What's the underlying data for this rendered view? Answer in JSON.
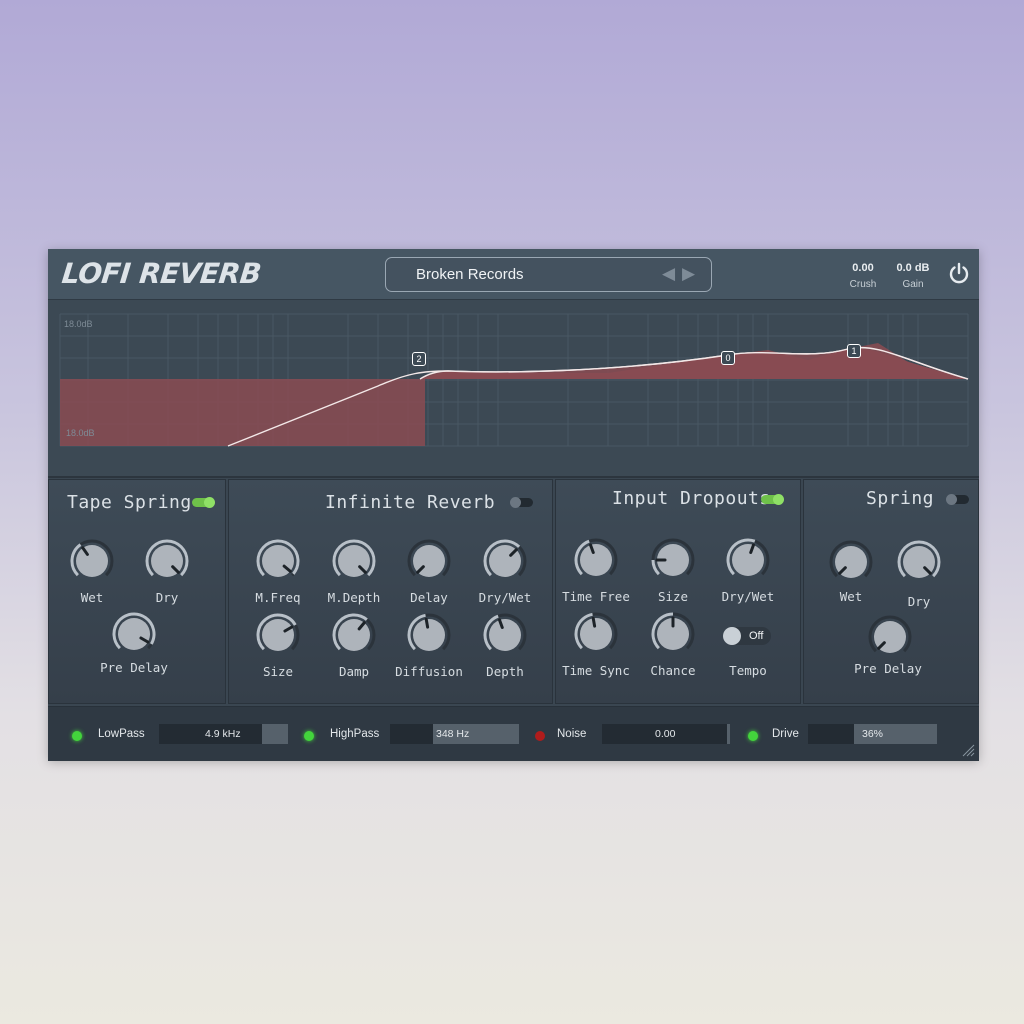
{
  "header": {
    "logo": "LOFI REVERB",
    "preset": "Broken Records",
    "crush_value": "0.00",
    "crush_label": "Crush",
    "gain_value": "0.0 dB",
    "gain_label": "Gain",
    "prev_icon": "triangle-left",
    "next_icon": "triangle-right",
    "power_icon": "power"
  },
  "eq": {
    "top_label": "18.0dB",
    "bottom_label": "18.0dB",
    "nodes": [
      "2",
      "0",
      "1"
    ],
    "fill_color": "#8a4b52",
    "curve_color": "#f3e8e8"
  },
  "panels": {
    "tape_spring": {
      "title": "Tape Spring",
      "enabled": true,
      "knobs": [
        "Wet",
        "Dry",
        "Pre Delay"
      ]
    },
    "infinite_reverb": {
      "title": "Infinite Reverb",
      "enabled": false,
      "knobs": [
        "M.Freq",
        "M.Depth",
        "Delay",
        "Dry/Wet",
        "Size",
        "Damp",
        "Diffusion",
        "Depth"
      ]
    },
    "input_dropouts": {
      "title": "Input Dropouts",
      "enabled": true,
      "knobs": [
        "Time Free",
        "Size",
        "Dry/Wet",
        "Time Sync",
        "Chance"
      ],
      "tempo_label": "Tempo",
      "tempo_state": "Off"
    },
    "spring": {
      "title": "Spring",
      "enabled": false,
      "knobs": [
        "Wet",
        "Dry",
        "Pre Delay"
      ]
    }
  },
  "bottom": {
    "lowpass": {
      "label": "LowPass",
      "value": "4.9 kHz",
      "led": "green",
      "fill": 0.2
    },
    "highpass": {
      "label": "HighPass",
      "value": "348 Hz",
      "led": "green",
      "fill": 0.67
    },
    "noise": {
      "label": "Noise",
      "value": "0.00",
      "led": "red",
      "fill": 0.02
    },
    "drive": {
      "label": "Drive",
      "value": "36%",
      "led": "green",
      "fill": 0.64
    }
  },
  "colors": {
    "accent_green": "#6fc14a",
    "led_green": "#43d43c",
    "led_red": "#b01c1c",
    "panel_bg": "#3a4651"
  }
}
